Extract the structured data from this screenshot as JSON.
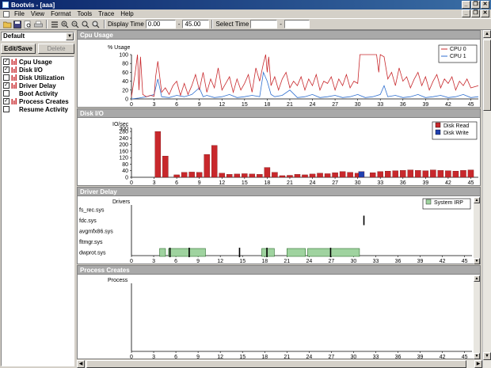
{
  "window": {
    "title": "Bootvis - [aaa]",
    "minimize_glyph": "_",
    "restore_glyph": "❐",
    "close_glyph": "✕"
  },
  "menu": [
    "File",
    "View",
    "Format",
    "Tools",
    "Trace",
    "Help"
  ],
  "toolbar": {
    "display_time_label": "Display Time",
    "display_time_from": "0.00",
    "dash": "-",
    "display_time_to": "45.00",
    "select_time_label": "Select Time",
    "select_time_from": "",
    "select_time_to": ""
  },
  "left": {
    "profile": "Default",
    "edit_save": "Edit/Save",
    "delete": "Delete",
    "items": [
      {
        "label": "Cpu Usage",
        "checked": true,
        "icon": true
      },
      {
        "label": "Disk I/O",
        "checked": true,
        "icon": true
      },
      {
        "label": "Disk Utilization",
        "checked": false,
        "icon": true
      },
      {
        "label": "Driver Delay",
        "checked": true,
        "icon": true
      },
      {
        "label": "Boot Activity",
        "checked": false,
        "icon": false
      },
      {
        "label": "Process Creates",
        "checked": true,
        "icon": true
      },
      {
        "label": "Resume Activity",
        "checked": false,
        "icon": false
      }
    ]
  },
  "colors": {
    "red": "#c8282c",
    "blue": "#2f6fd0",
    "green": "#9fd39f",
    "panel_header": "#a9a9a9"
  },
  "panels": {
    "cpu": "Cpu Usage",
    "disk": "Disk I/O",
    "driver": "Driver Delay",
    "process": "Process Creates"
  },
  "chart_data": [
    {
      "type": "line",
      "title": "Cpu Usage",
      "ylabel": "% Usage",
      "xlim": [
        0,
        46
      ],
      "ylim": [
        0,
        100
      ],
      "xticks": [
        0,
        3,
        6,
        9,
        12,
        15,
        18,
        21,
        24,
        27,
        30,
        33,
        36,
        39,
        42,
        45
      ],
      "yticks": [
        0,
        20,
        40,
        60,
        80,
        100
      ],
      "legend": "top-right",
      "series": [
        {
          "name": "CPU 0",
          "color": "#c8282c",
          "x": [
            0,
            0.5,
            0.8,
            1,
            1.2,
            1.5,
            2,
            2.5,
            3,
            3.2,
            3.5,
            4,
            4.5,
            5,
            5.5,
            6,
            6.5,
            7,
            7.5,
            8,
            8.5,
            9,
            9.5,
            10,
            10.5,
            11,
            11.5,
            12,
            12.5,
            13,
            13.5,
            14,
            14.5,
            15,
            15.5,
            16,
            16.5,
            17,
            17.5,
            17.8,
            18,
            18.2,
            18.5,
            19,
            19.5,
            20,
            20.5,
            21,
            21.5,
            22,
            22.5,
            23,
            23.5,
            24,
            24.5,
            25,
            25.5,
            26,
            26.5,
            27,
            27.5,
            28,
            28.5,
            29,
            29.5,
            30,
            30.3,
            30.6,
            31,
            31.5,
            32,
            32.5,
            32.8,
            33,
            33.5,
            34,
            34.5,
            35,
            35.5,
            36,
            36.5,
            37,
            37.5,
            38,
            38.5,
            39,
            39.5,
            40,
            40.5,
            41,
            41.5,
            42,
            42.5,
            43,
            43.5,
            44,
            44.5,
            45,
            46
          ],
          "y": [
            5,
            60,
            100,
            20,
            95,
            10,
            5,
            8,
            6,
            50,
            85,
            15,
            25,
            10,
            30,
            40,
            8,
            35,
            10,
            30,
            55,
            20,
            60,
            15,
            45,
            25,
            70,
            20,
            35,
            50,
            15,
            45,
            20,
            35,
            55,
            15,
            70,
            40,
            80,
            100,
            60,
            95,
            30,
            50,
            20,
            45,
            60,
            25,
            40,
            30,
            50,
            20,
            45,
            30,
            55,
            20,
            40,
            35,
            50,
            20,
            45,
            30,
            55,
            25,
            40,
            35,
            100,
            100,
            100,
            100,
            100,
            100,
            60,
            100,
            95,
            45,
            60,
            30,
            70,
            40,
            50,
            25,
            45,
            60,
            30,
            50,
            20,
            40,
            55,
            25,
            45,
            35,
            50,
            20,
            40,
            30,
            45,
            25,
            30
          ]
        },
        {
          "name": "CPU 1",
          "color": "#2f6fd0",
          "x": [
            0,
            1,
            2,
            3,
            3.5,
            4,
            5,
            6,
            7,
            8,
            9,
            9.5,
            10,
            11,
            12,
            13,
            14,
            15,
            16,
            17,
            17.5,
            18,
            18.5,
            19,
            20,
            21,
            22,
            23,
            24,
            25,
            26,
            27,
            28,
            29,
            30,
            31,
            32,
            33,
            33.5,
            34,
            35,
            36,
            37,
            38,
            39,
            40,
            41,
            42,
            43,
            44,
            45,
            46
          ],
          "y": [
            0,
            2,
            5,
            10,
            45,
            5,
            3,
            8,
            5,
            10,
            25,
            5,
            8,
            3,
            5,
            10,
            3,
            5,
            8,
            5,
            60,
            40,
            10,
            5,
            8,
            20,
            3,
            5,
            10,
            3,
            5,
            8,
            3,
            5,
            10,
            3,
            5,
            10,
            30,
            5,
            8,
            3,
            5,
            10,
            3,
            5,
            8,
            3,
            5,
            10,
            3,
            5
          ]
        }
      ]
    },
    {
      "type": "bar",
      "title": "Disk I/O",
      "ylabel": "IO/sec",
      "xlim": [
        0,
        46
      ],
      "ylim": [
        0,
        300
      ],
      "xticks": [
        0,
        3,
        6,
        9,
        12,
        15,
        18,
        21,
        24,
        27,
        30,
        33,
        36,
        39,
        42,
        45
      ],
      "yticks": [
        0,
        40,
        80,
        120,
        160,
        200,
        240,
        280,
        300
      ],
      "legend": "top-right",
      "series": [
        {
          "name": "Disk Read",
          "color": "#c8282c",
          "x": [
            3.5,
            4.5,
            6,
            7,
            8,
            9,
            10,
            11,
            12,
            13,
            14,
            15,
            16,
            17,
            18,
            19,
            20,
            21,
            22,
            23,
            24,
            25,
            26,
            27,
            28,
            29,
            30,
            32,
            33,
            34,
            35,
            36,
            37,
            38,
            39,
            40,
            41,
            42,
            43,
            44,
            45
          ],
          "y": [
            280,
            130,
            15,
            30,
            32,
            30,
            140,
            195,
            25,
            18,
            20,
            22,
            20,
            18,
            60,
            30,
            10,
            12,
            18,
            15,
            20,
            25,
            22,
            28,
            35,
            30,
            25,
            28,
            35,
            38,
            40,
            42,
            45,
            42,
            40,
            45,
            42,
            40,
            38,
            42,
            45
          ]
        },
        {
          "name": "Disk Write",
          "color": "#2040b0",
          "x": [
            30.5
          ],
          "y": [
            35
          ]
        }
      ]
    },
    {
      "type": "timeline",
      "title": "Driver Delay",
      "ylabel": "Drivers",
      "xlim": [
        0,
        46
      ],
      "xticks": [
        0,
        3,
        6,
        9,
        12,
        15,
        18,
        21,
        24,
        27,
        30,
        33,
        36,
        39,
        42,
        45
      ],
      "categories": [
        "fs_rec.sys",
        "fdc.sys",
        "avgmfx86.sys",
        "fltmgr.sys",
        "dwprot.sys"
      ],
      "legend": "top-right",
      "series": [
        {
          "name": "System IRP",
          "color": "#9fd39f",
          "spans": [
            {
              "driver": "dwprot.sys",
              "start": 3.8,
              "end": 4.6
            },
            {
              "driver": "dwprot.sys",
              "start": 5.0,
              "end": 10.0
            },
            {
              "driver": "dwprot.sys",
              "start": 17.6,
              "end": 19.3
            },
            {
              "driver": "dwprot.sys",
              "start": 21.0,
              "end": 23.5
            },
            {
              "driver": "dwprot.sys",
              "start": 23.8,
              "end": 30.8
            }
          ],
          "markers": [
            {
              "driver": "dwprot.sys",
              "at": 5.2
            },
            {
              "driver": "dwprot.sys",
              "at": 7.8
            },
            {
              "driver": "dwprot.sys",
              "at": 14.6
            },
            {
              "driver": "dwprot.sys",
              "at": 18.3
            },
            {
              "driver": "dwprot.sys",
              "at": 26.9
            },
            {
              "driver": "fdc.sys",
              "at": 31.4
            }
          ]
        }
      ]
    },
    {
      "type": "timeline",
      "title": "Process Creates",
      "ylabel": "Process",
      "xlim": [
        0,
        46
      ],
      "xticks": [
        0,
        3,
        6,
        9,
        12,
        15,
        18,
        21,
        24,
        27,
        30,
        33,
        36,
        39,
        42,
        45
      ]
    }
  ]
}
